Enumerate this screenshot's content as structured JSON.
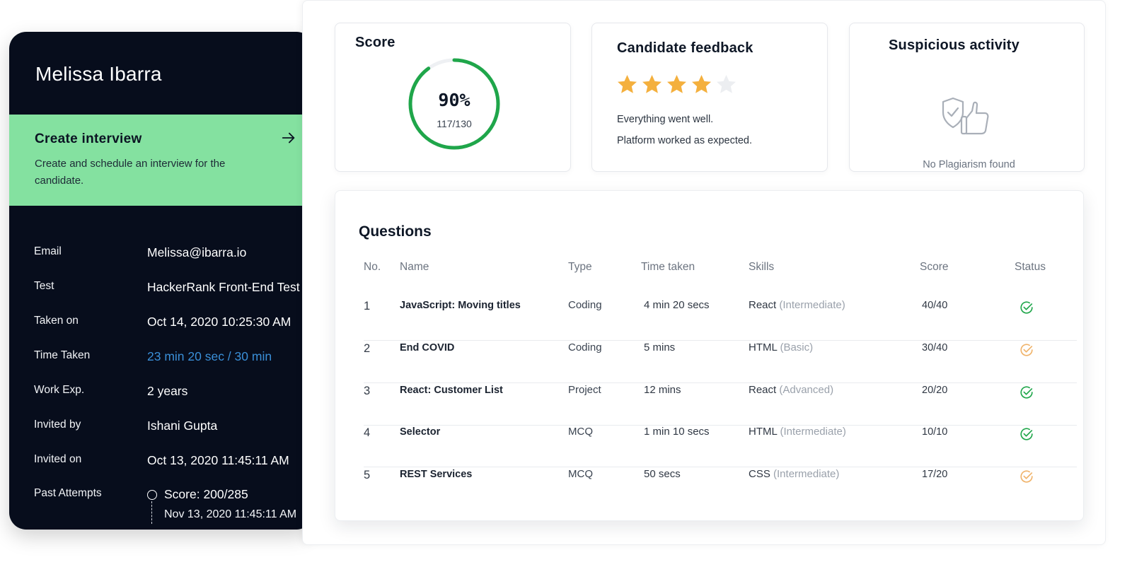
{
  "candidate": {
    "name": "Melissa Ibarra",
    "create_interview": {
      "title": "Create interview",
      "description": "Create and schedule an interview for the candidate.",
      "icon": "arrow-right-icon"
    },
    "fields": [
      {
        "label": "Email",
        "value": "Melissa@ibarra.io"
      },
      {
        "label": "Test",
        "value": "HackerRank Front-End Test"
      },
      {
        "label": "Taken on",
        "value": "Oct 14, 2020  10:25:30 AM"
      },
      {
        "label": "Time Taken",
        "value": "23 min 20 sec / 30 min"
      },
      {
        "label": "Work Exp.",
        "value": "2 years"
      },
      {
        "label": "Invited by",
        "value": "Ishani Gupta"
      },
      {
        "label": "Invited on",
        "value": "Oct 13, 2020  11:45:11 AM"
      }
    ],
    "past_attempts": {
      "label": "Past Attempts",
      "score": "Score: 200/285",
      "date": "Nov 13, 2020  11:45:11 AM"
    }
  },
  "score": {
    "title": "Score",
    "percent_text": "90%",
    "fraction_text": "117/130",
    "percent_value": 90,
    "ring_color": "#1fa64a",
    "track_color": "#eef0f3"
  },
  "feedback": {
    "title": "Candidate feedback",
    "rating": 4,
    "max_rating": 5,
    "star_color": "#f4b03e",
    "star_empty_color": "#eceef1",
    "lines": [
      "Everything went well.",
      "Platform worked as expected."
    ]
  },
  "suspicious": {
    "title": "Suspicious activity",
    "icon": "shield-thumbs-up-icon",
    "text": "No Plagiarism found"
  },
  "questions": {
    "title": "Questions",
    "headers": [
      "No.",
      "Name",
      "Type",
      "Time taken",
      "Skills",
      "Score",
      "Status"
    ],
    "rows": [
      {
        "no": "1",
        "name": "JavaScript: Moving titles",
        "type": "Coding",
        "time": "4 min 20 secs",
        "skill": "React",
        "level": "(Intermediate)",
        "score": "40/40",
        "status": "complete"
      },
      {
        "no": "2",
        "name": "End COVID",
        "type": "Coding",
        "time": "5 mins",
        "skill": "HTML",
        "level": "(Basic)",
        "score": "30/40",
        "status": "partial"
      },
      {
        "no": "3",
        "name": "React: Customer List",
        "type": "Project",
        "time": "12 mins",
        "skill": "React",
        "level": "(Advanced)",
        "score": "20/20",
        "status": "complete"
      },
      {
        "no": "4",
        "name": "Selector",
        "type": "MCQ",
        "time": "1 min 10 secs",
        "skill": "HTML",
        "level": "(Intermediate)",
        "score": "10/10",
        "status": "complete"
      },
      {
        "no": "5",
        "name": "REST Services",
        "type": "MCQ",
        "time": "50 secs",
        "skill": "CSS",
        "level": "(Intermediate)",
        "score": "17/20",
        "status": "partial"
      }
    ],
    "status_colors": {
      "complete": "#1fa64a",
      "partial": "#f0b36a"
    }
  }
}
